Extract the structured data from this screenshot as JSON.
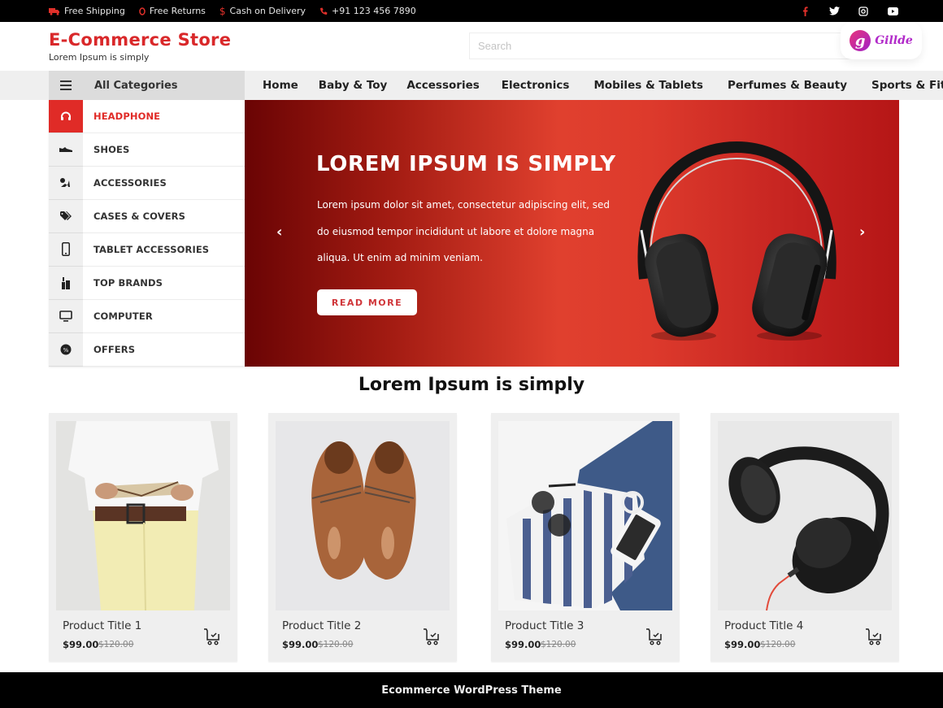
{
  "topbar": {
    "info": [
      {
        "icon": "truck-icon",
        "label": "Free Shipping"
      },
      {
        "icon": "returns-icon",
        "label": "Free Returns"
      },
      {
        "icon": "dollar-icon",
        "label": "Cash on Delivery"
      },
      {
        "icon": "phone-icon",
        "label": "+91 123 456 7890"
      }
    ],
    "social": [
      "facebook-icon",
      "twitter-icon",
      "instagram-icon",
      "youtube-icon"
    ]
  },
  "header": {
    "title": "E-Commerce Store",
    "tagline": "Lorem Ipsum is simply",
    "search_placeholder": "Search",
    "badge_name": "Gillde",
    "badge_letter": "g"
  },
  "nav": {
    "all_categories": "All Categories",
    "items": [
      "Home",
      "Baby & Toy",
      "Accessories",
      "Electronics",
      "Mobiles & Tablets",
      "Perfumes & Beauty",
      "Sports & Fitness"
    ]
  },
  "sidebar": {
    "items": [
      {
        "icon": "headphone-icon",
        "label": "HEADPHONE",
        "active": true
      },
      {
        "icon": "shoe-icon",
        "label": "SHOES"
      },
      {
        "icon": "accessories-icon",
        "label": "ACCESSORIES"
      },
      {
        "icon": "tags-icon",
        "label": "CASES & COVERS"
      },
      {
        "icon": "tablet-icon",
        "label": "TABLET ACCESSORIES"
      },
      {
        "icon": "brands-icon",
        "label": "TOP BRANDS"
      },
      {
        "icon": "monitor-icon",
        "label": "COMPUTER"
      },
      {
        "icon": "percent-icon",
        "label": "OFFERS"
      }
    ]
  },
  "hero": {
    "title": "LOREM IPSUM IS SIMPLY",
    "text": "Lorem ipsum dolor sit amet, consectetur adipiscing elit, sed do eiusmod tempor incididunt ut labore et dolore magna aliqua. Ut enim ad minim veniam.",
    "button": "READ MORE",
    "prev": "‹",
    "next": "›"
  },
  "section": {
    "title": "Lorem Ipsum is simply"
  },
  "products": [
    {
      "title": "Product Title 1",
      "price": "$99.00",
      "old_price": "$120.00",
      "image": "man-reading-book"
    },
    {
      "title": "Product Title 2",
      "price": "$99.00",
      "old_price": "$120.00",
      "image": "brown-leather-shoes"
    },
    {
      "title": "Product Title 3",
      "price": "$99.00",
      "old_price": "$120.00",
      "image": "striped-shirt-sunglasses-phone"
    },
    {
      "title": "Product Title 4",
      "price": "$99.00",
      "old_price": "$120.00",
      "image": "black-headphones"
    }
  ],
  "footer": {
    "text": "Ecommerce WordPress Theme"
  },
  "colors": {
    "accent": "#e02b27",
    "brand_title": "#d9282a",
    "topbar": "#000000",
    "footer": "#000000"
  }
}
